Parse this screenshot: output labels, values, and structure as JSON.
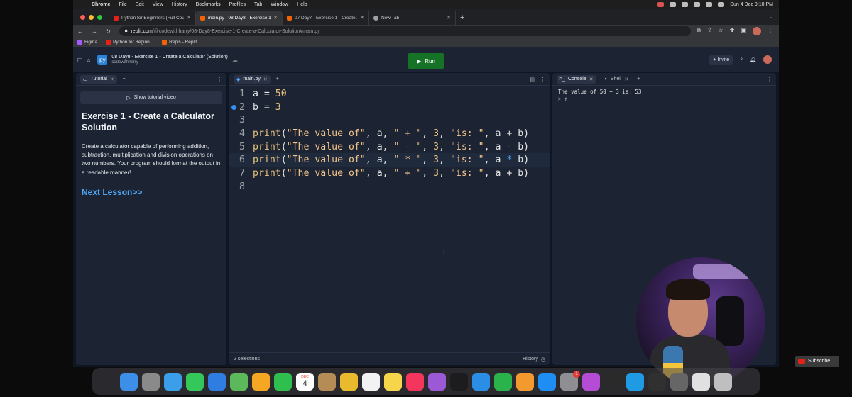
{
  "menubar": {
    "apple": "",
    "app": "Chrome",
    "items": [
      "File",
      "Edit",
      "View",
      "History",
      "Bookmarks",
      "Profiles",
      "Tab",
      "Window",
      "Help"
    ],
    "datetime": "Sun 4 Dec  9:10 PM"
  },
  "browser": {
    "tabs": [
      {
        "title": "Python for Beginners (Full Cou",
        "color": "#e62117"
      },
      {
        "title": "main.py - 08 Day8 - Exercise 1",
        "color": "#f26207"
      },
      {
        "title": "07 Day7 - Exercise 1 - Create a",
        "color": "#f26207"
      },
      {
        "title": "New Tab",
        "color": "#9aa0a6"
      }
    ],
    "url_host": "replit.com",
    "url_path": "/@codewithharry/08-Day8-Exercise-1-Create-a-Calculator-Solution#main.py",
    "bookmarks": [
      {
        "label": "Figma",
        "color": "#a259ff"
      },
      {
        "label": "Python for Beginn...",
        "color": "#e62117"
      },
      {
        "label": "Repls - Replit",
        "color": "#f26207"
      }
    ]
  },
  "replit": {
    "repl_title": "08 Day8 - Exercise 1 - Create a Calculator (Solution)",
    "owner": "codewithharry",
    "run_label": "Run",
    "invite_label": "Invite"
  },
  "tutorial": {
    "tab_label": "Tutorial",
    "show_video": "Show tutorial video",
    "title": "Exercise 1 - Create a Calculator Solution",
    "description": "Create a calculator capable of performing addition, subtraction, multiplication and division operations on two numbers. Your program should format the output in a readable manner!",
    "next_lesson": "Next Lesson>>"
  },
  "editor": {
    "tab_label": "main.py",
    "line_numbers": [
      "1",
      "2",
      "3",
      "4",
      "5",
      "6",
      "7",
      "8"
    ],
    "status_left": "2 selections",
    "history_label": "History"
  },
  "console": {
    "tab_console": "Console",
    "tab_shell": "Shell",
    "output": "The value of 50  +  3 is:  53",
    "prompt": ">"
  },
  "overlay": {
    "subscribe": "Subscribe"
  },
  "dock": {
    "calendar_month": "DEC",
    "calendar_day": "4",
    "badge": "1",
    "apps": [
      {
        "name": "finder-icon",
        "color": "#3d8ee6"
      },
      {
        "name": "launchpad-icon",
        "color": "#8a8a8a"
      },
      {
        "name": "safari-icon",
        "color": "#3b9ee8"
      },
      {
        "name": "messages-icon",
        "color": "#34c759"
      },
      {
        "name": "mail-icon",
        "color": "#2f7de1"
      },
      {
        "name": "maps-icon",
        "color": "#5db85b"
      },
      {
        "name": "photos-icon",
        "color": "#f5a623"
      },
      {
        "name": "facetime-icon",
        "color": "#2fbf4f"
      },
      {
        "name": "calendar-icon",
        "color": "#ffffff"
      },
      {
        "name": "contacts-icon",
        "color": "#b58b56"
      },
      {
        "name": "chrome-icon",
        "color": "#e9ba2e"
      },
      {
        "name": "reminders-icon",
        "color": "#f2f2f2"
      },
      {
        "name": "notes-icon",
        "color": "#f7d54a"
      },
      {
        "name": "music-icon",
        "color": "#f5365c"
      },
      {
        "name": "podcasts-icon",
        "color": "#9b59d6"
      },
      {
        "name": "tv-icon",
        "color": "#1c1c1e"
      },
      {
        "name": "keynote-icon",
        "color": "#2a8de6"
      },
      {
        "name": "numbers-icon",
        "color": "#29b34a"
      },
      {
        "name": "pages-icon",
        "color": "#f29a2e"
      },
      {
        "name": "appstore-icon",
        "color": "#1e8ef5"
      },
      {
        "name": "system-preferences-icon",
        "color": "#8e8e93"
      },
      {
        "name": "feedback-icon",
        "color": "#b44cd6"
      },
      {
        "name": "terminal-icon",
        "color": "#2a2a2a"
      },
      {
        "name": "skype-icon",
        "color": "#1e9be3"
      },
      {
        "name": "obs-icon",
        "color": "#303030"
      },
      {
        "name": "screenshot-icon",
        "color": "#666666"
      },
      {
        "name": "downloads-icon",
        "color": "#e0e0e0"
      },
      {
        "name": "trash-icon",
        "color": "#bfbfbf"
      }
    ]
  }
}
